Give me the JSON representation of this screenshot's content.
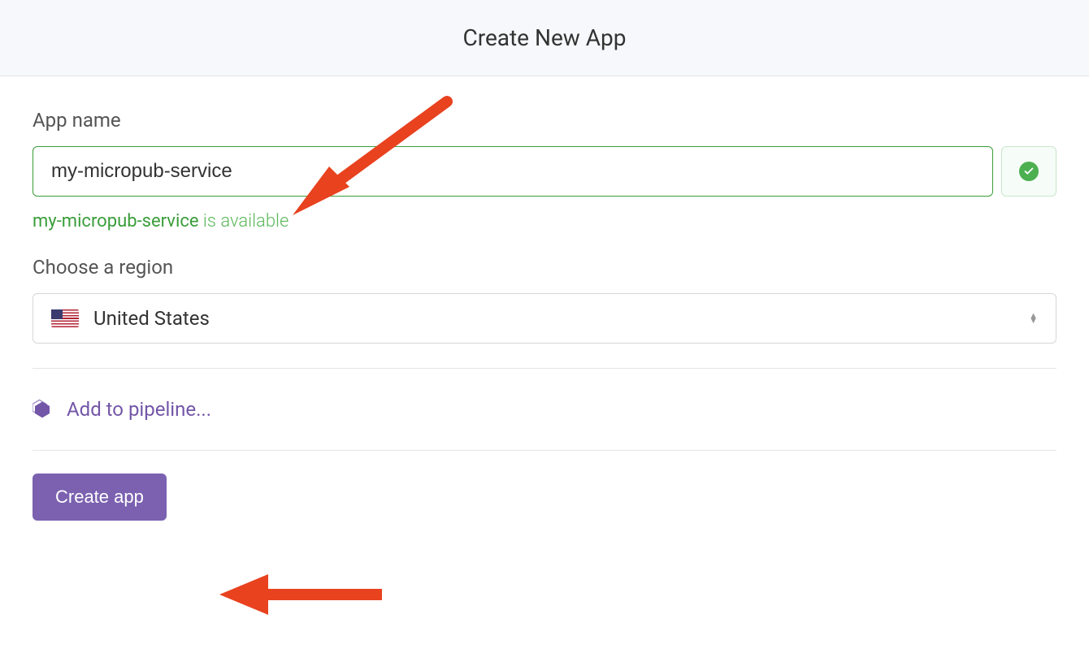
{
  "header": {
    "title": "Create New App"
  },
  "form": {
    "appName": {
      "label": "App name",
      "value": "my-micropub-service",
      "availability": {
        "name": "my-micropub-service",
        "suffix": " is available"
      }
    },
    "region": {
      "label": "Choose a region",
      "selected": "United States"
    },
    "pipeline": {
      "text": "Add to pipeline..."
    },
    "submit": {
      "label": "Create app"
    }
  }
}
